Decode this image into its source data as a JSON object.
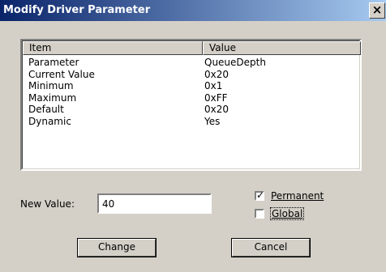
{
  "window": {
    "title": "Modify Driver Parameter",
    "close_glyph": "×"
  },
  "list": {
    "columns": [
      "Item",
      "Value"
    ],
    "rows": [
      {
        "item": "Parameter",
        "value": "QueueDepth"
      },
      {
        "item": "Current Value",
        "value": "0x20"
      },
      {
        "item": "Minimum",
        "value": "0x1"
      },
      {
        "item": "Maximum",
        "value": "0xFF"
      },
      {
        "item": "Default",
        "value": "0x20"
      },
      {
        "item": "Dynamic",
        "value": "Yes"
      }
    ]
  },
  "new_value": {
    "label": "New Value:",
    "value": "40"
  },
  "options": {
    "permanent": {
      "label": "Permanent",
      "checked": true,
      "check_glyph": "✓"
    },
    "global": {
      "label": "Global",
      "checked": false
    }
  },
  "buttons": {
    "change": "Change",
    "cancel": "Cancel"
  },
  "colors": {
    "dialog_bg": "#d4d0c8",
    "title_start": "#0a246a",
    "title_end": "#a6caf0"
  }
}
